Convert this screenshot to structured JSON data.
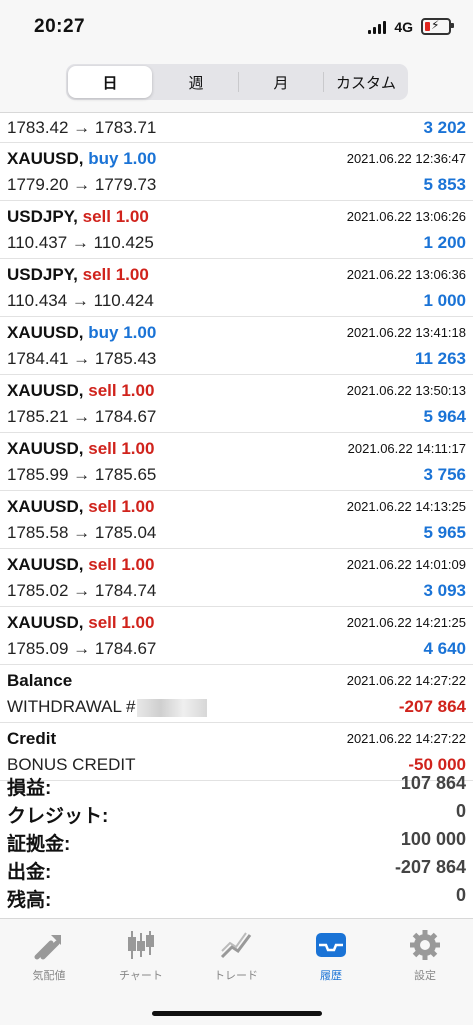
{
  "status": {
    "time": "20:27",
    "network": "4G"
  },
  "tabs": [
    "日",
    "週",
    "月",
    "カスタム"
  ],
  "history": [
    {
      "price": "1783.42 → 1783.71",
      "profit": "3 202"
    },
    {
      "symbol": "XAUUSD,",
      "type": "buy 1.00",
      "date": "2021.06.22 12:36:47",
      "price": "1779.20 → 1779.73",
      "profit": "5 853"
    },
    {
      "symbol": "USDJPY,",
      "type": "sell 1.00",
      "date": "2021.06.22 13:06:26",
      "price": "110.437 → 110.425",
      "profit": "1 200"
    },
    {
      "symbol": "USDJPY,",
      "type": "sell 1.00",
      "date": "2021.06.22 13:06:36",
      "price": "110.434 → 110.424",
      "profit": "1 000"
    },
    {
      "symbol": "XAUUSD,",
      "type": "buy 1.00",
      "date": "2021.06.22 13:41:18",
      "price": "1784.41 → 1785.43",
      "profit": "11 263"
    },
    {
      "symbol": "XAUUSD,",
      "type": "sell 1.00",
      "date": "2021.06.22 13:50:13",
      "price": "1785.21 → 1784.67",
      "profit": "5 964"
    },
    {
      "symbol": "XAUUSD,",
      "type": "sell 1.00",
      "date": "2021.06.22 14:11:17",
      "price": "1785.99 → 1785.65",
      "profit": "3 756"
    },
    {
      "symbol": "XAUUSD,",
      "type": "sell 1.00",
      "date": "2021.06.22 14:13:25",
      "price": "1785.58 → 1785.04",
      "profit": "5 965"
    },
    {
      "symbol": "XAUUSD,",
      "type": "sell 1.00",
      "date": "2021.06.22 14:01:09",
      "price": "1785.02 → 1784.74",
      "profit": "3 093"
    },
    {
      "symbol": "XAUUSD,",
      "type": "sell 1.00",
      "date": "2021.06.22 14:21:25",
      "price": "1785.09 → 1784.67",
      "profit": "4 640"
    },
    {
      "symbol": "Balance",
      "date": "2021.06.22 14:27:22",
      "price": "WITHDRAWAL #",
      "profit": "-207 864"
    },
    {
      "symbol": "Credit",
      "date": "2021.06.22 14:27:22",
      "price": "BONUS CREDIT",
      "profit": "-50 000"
    }
  ],
  "summary": [
    {
      "label": "損益:",
      "value": "107 864"
    },
    {
      "label": "クレジット:",
      "value": "0"
    },
    {
      "label": "証拠金:",
      "value": "100 000"
    },
    {
      "label": "出金:",
      "value": "-207 864"
    },
    {
      "label": "残高:",
      "value": "0"
    }
  ],
  "tabbar": [
    "気配値",
    "チャート",
    "トレード",
    "履歴",
    "設定"
  ],
  "colors": {
    "buy": "#1a73d6",
    "sell": "#d0231c",
    "accent": "#1a73d6"
  }
}
